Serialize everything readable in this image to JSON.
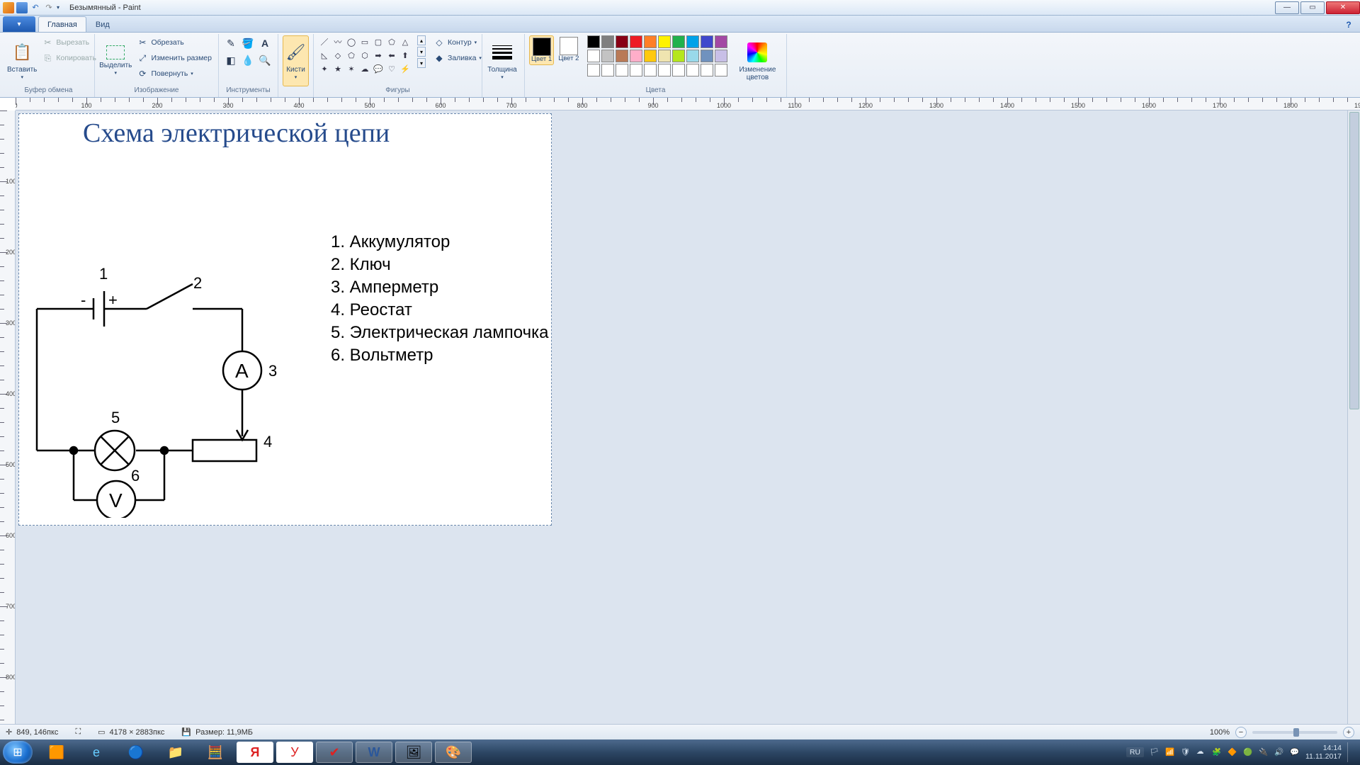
{
  "title": "Безымянный - Paint",
  "tabs": {
    "file": "▾",
    "home": "Главная",
    "view": "Вид"
  },
  "ribbon": {
    "clipboard": {
      "label": "Буфер обмена",
      "paste": "Вставить",
      "cut": "Вырезать",
      "copy": "Копировать"
    },
    "image": {
      "label": "Изображение",
      "select": "Выделить",
      "crop": "Обрезать",
      "resize": "Изменить размер",
      "rotate": "Повернуть"
    },
    "tools": {
      "label": "Инструменты"
    },
    "brushes": {
      "label": "Кисти",
      "btn": "Кисти"
    },
    "shapes": {
      "label": "Фигуры",
      "outline": "Контур",
      "fill": "Заливка"
    },
    "size": {
      "label": "Толщина",
      "btn": "Толщина"
    },
    "colors": {
      "label": "Цвета",
      "c1": "Цвет 1",
      "c2": "Цвет 2",
      "edit": "Изменение цветов",
      "palette_row1": [
        "#000000",
        "#7f7f7f",
        "#880015",
        "#ed1c24",
        "#ff7f27",
        "#fff200",
        "#22b14c",
        "#00a2e8",
        "#3f48cc",
        "#a349a4"
      ],
      "palette_row2": [
        "#ffffff",
        "#c3c3c3",
        "#b97a57",
        "#ffaec9",
        "#ffc90e",
        "#efe4b0",
        "#b5e61d",
        "#99d9ea",
        "#7092be",
        "#c8bfe7"
      ],
      "palette_row3": [
        "#ffffff",
        "#ffffff",
        "#ffffff",
        "#ffffff",
        "#ffffff",
        "#ffffff",
        "#ffffff",
        "#ffffff",
        "#ffffff",
        "#ffffff"
      ]
    }
  },
  "canvas": {
    "title": "Схема электрической цепи",
    "legend": [
      "1. Аккумулятор",
      "2. Ключ",
      "3. Амперметр",
      "4. Реостат",
      "5. Электрическая лампочка",
      "6. Вольтметр"
    ],
    "labels": {
      "n1": "1",
      "n2": "2",
      "n3": "3",
      "n4": "4",
      "n5": "5",
      "n6": "6",
      "minus": "-",
      "plus": "+",
      "A": "A",
      "V": "V"
    }
  },
  "status": {
    "cursor_icon": "✛",
    "cursor": "849, 146пкс",
    "sel_icon": "⛶",
    "canvas_icon": "▭",
    "canvas_size": "4178 × 2883пкс",
    "disk_icon": "💾",
    "file_size": "Размер: 11,9МБ",
    "zoom_pct": "100%"
  },
  "taskbar": {
    "lang": "RU",
    "time": "14:14",
    "date": "11.11.2017"
  }
}
